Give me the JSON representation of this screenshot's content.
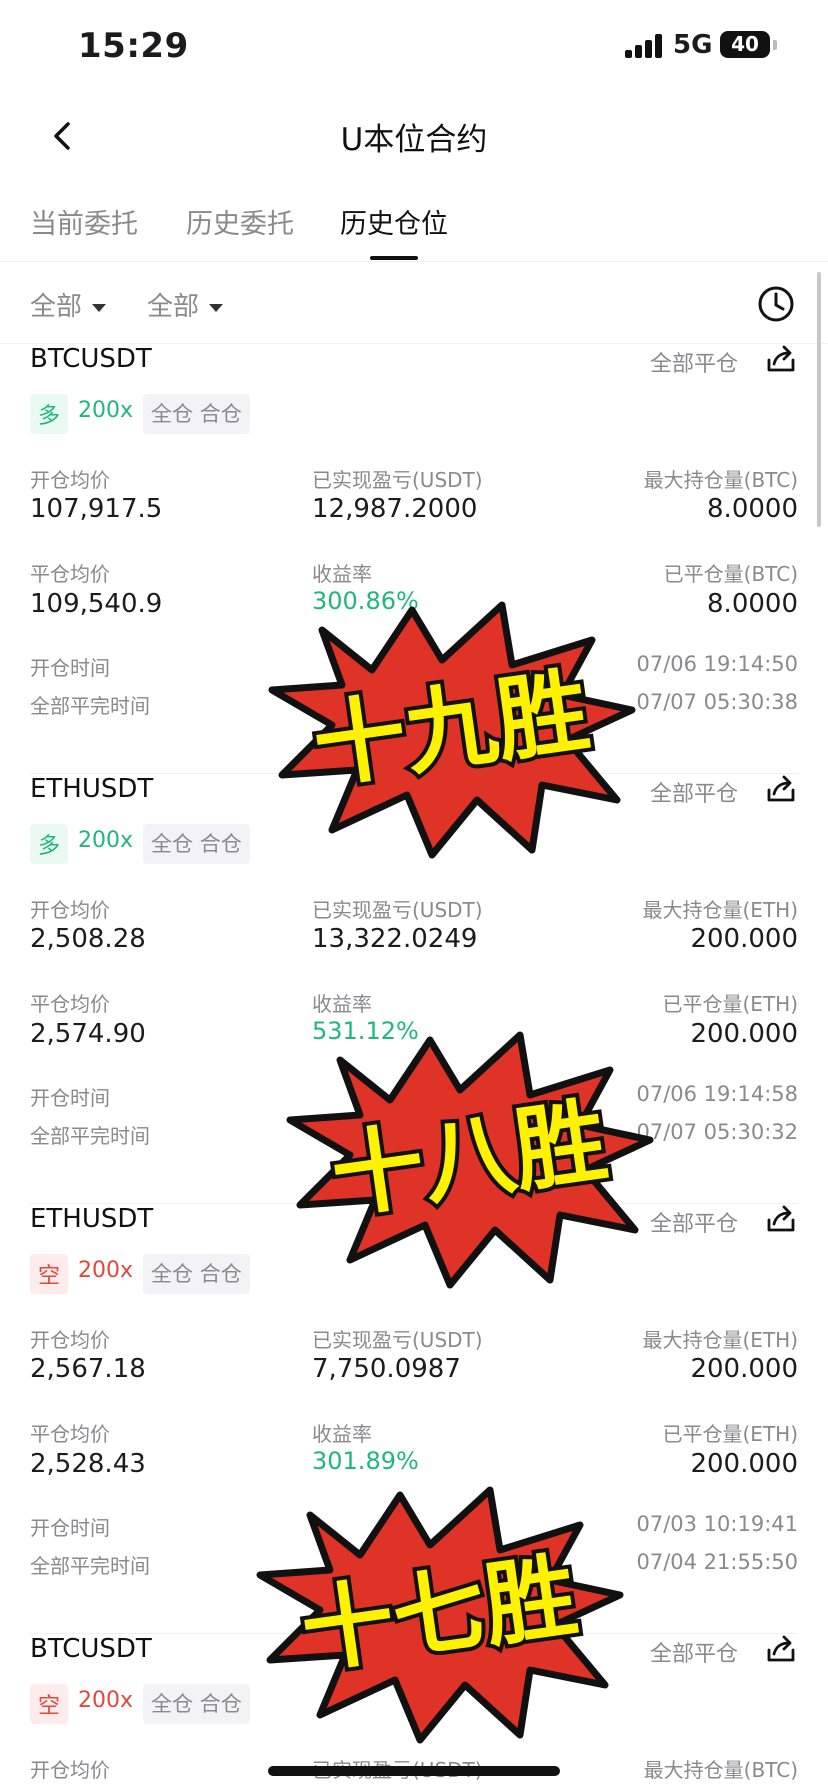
{
  "status_bar": {
    "time": "15:29",
    "network": "5G",
    "battery": "40"
  },
  "header": {
    "title": "U本位合约"
  },
  "tabs": [
    {
      "label": "当前委托"
    },
    {
      "label": "历史委托"
    },
    {
      "label": "历史仓位",
      "active": true
    }
  ],
  "filters": [
    {
      "label": "全部"
    },
    {
      "label": "全部"
    }
  ],
  "icons": {
    "back": "chevron-left-icon",
    "history": "clock-icon",
    "share": "share-icon"
  },
  "colors": {
    "profit_green": "#1fb87a",
    "short_red": "#e5473c",
    "sticker_red": "#e03327",
    "sticker_yellow": "#fff200"
  },
  "positions": [
    {
      "symbol": "BTCUSDT",
      "close_all": "全部平仓",
      "direction": "多",
      "leverage": "200x",
      "margin_mode": "全仓 合仓",
      "open_avg_label": "开仓均价",
      "open_avg": "107,917.5",
      "pnl_label": "已实现盈亏(USDT)",
      "pnl": "12,987.2000",
      "max_pos_label": "最大持仓量(BTC)",
      "max_pos": "8.0000",
      "close_avg_label": "平仓均价",
      "close_avg": "109,540.9",
      "roi_label": "收益率",
      "roi": "300.86%",
      "closed_label": "已平仓量(BTC)",
      "closed": "8.0000",
      "open_time_label": "开仓时间",
      "open_time": "07/06 19:14:50",
      "close_time_label": "全部平完时间",
      "close_time": "07/07 05:30:38"
    },
    {
      "symbol": "ETHUSDT",
      "close_all": "全部平仓",
      "direction": "多",
      "leverage": "200x",
      "margin_mode": "全仓 合仓",
      "open_avg_label": "开仓均价",
      "open_avg": "2,508.28",
      "pnl_label": "已实现盈亏(USDT)",
      "pnl": "13,322.0249",
      "max_pos_label": "最大持仓量(ETH)",
      "max_pos": "200.000",
      "close_avg_label": "平仓均价",
      "close_avg": "2,574.90",
      "roi_label": "收益率",
      "roi": "531.12%",
      "closed_label": "已平仓量(ETH)",
      "closed": "200.000",
      "open_time_label": "开仓时间",
      "open_time": "07/06 19:14:58",
      "close_time_label": "全部平完时间",
      "close_time": "07/07 05:30:32"
    },
    {
      "symbol": "ETHUSDT",
      "close_all": "全部平仓",
      "direction": "空",
      "leverage": "200x",
      "margin_mode": "全仓 合仓",
      "open_avg_label": "开仓均价",
      "open_avg": "2,567.18",
      "pnl_label": "已实现盈亏(USDT)",
      "pnl": "7,750.0987",
      "max_pos_label": "最大持仓量(ETH)",
      "max_pos": "200.000",
      "close_avg_label": "平仓均价",
      "close_avg": "2,528.43",
      "roi_label": "收益率",
      "roi": "301.89%",
      "closed_label": "已平仓量(ETH)",
      "closed": "200.000",
      "open_time_label": "开仓时间",
      "open_time": "07/03 10:19:41",
      "close_time_label": "全部平完时间",
      "close_time": "07/04 21:55:50"
    },
    {
      "symbol": "BTCUSDT",
      "close_all": "全部平仓",
      "direction": "空",
      "leverage": "200x",
      "margin_mode": "全仓 合仓",
      "open_avg_label": "开仓均价",
      "pnl_label": "已实现盈亏(USDT)",
      "max_pos_label": "最大持仓量(BTC)"
    }
  ],
  "stickers": [
    {
      "text": "十九胜"
    },
    {
      "text": "十八胜"
    },
    {
      "text": "十七胜"
    }
  ]
}
